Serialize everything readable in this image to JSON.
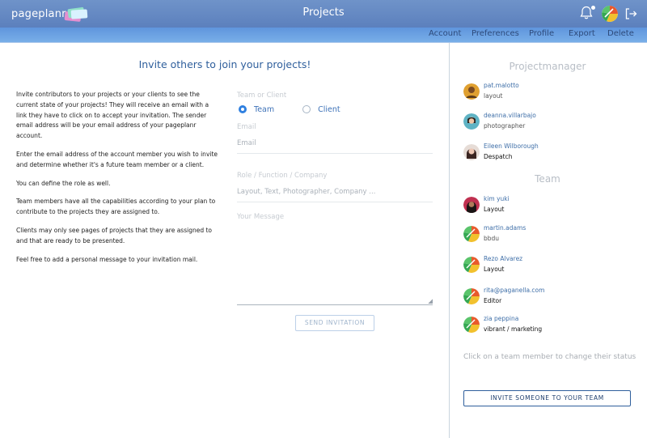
{
  "header": {
    "logo_text": "pageplanr",
    "title": "Projects",
    "icons": [
      "bell-icon",
      "user-avatar",
      "logout-icon"
    ]
  },
  "subnav": {
    "items": [
      "Account",
      "Preferences",
      "Profile",
      "Export",
      "Delete"
    ]
  },
  "main": {
    "title": "Invite others to join your projects!",
    "info": [
      "Invite contributors to your projects or your clients to see the current state of your projects! They will receive an email with a link they have to click on to accept your invitation. The sender email address will be your email address of your pageplanr account.",
      "Enter the email address of the account member you wish to invite and determine whether it's a future team member or a client.",
      "You can define the role as well.",
      "Team members have all the capabilities according to your plan to contribute to the projects they are assigned to.",
      "Clients may only see pages of projects that they are assigned to and that are ready to be presented.",
      "Feel free to add a personal message to your invitation mail."
    ],
    "form": {
      "team_or_client_label": "Team or Client",
      "option_team": "Team",
      "option_client": "Client",
      "selected": "Team",
      "email_label": "Email",
      "email_placeholder": "Email",
      "role_label": "Role / Function / Company",
      "role_placeholder": "Layout, Text, Photographer, Company ...",
      "message_label": "Your Message",
      "send_button": "SEND INVITATION"
    }
  },
  "sidebar": {
    "projectmanager_heading": "Projectmanager",
    "projectmanagers": [
      {
        "name": "pat.malotto",
        "role": "layout"
      },
      {
        "name": "deanna.villarbajo",
        "role": "photographer"
      },
      {
        "name": "Eileen Wilborough",
        "role": "Despatch"
      }
    ],
    "team_heading": "Team",
    "team": [
      {
        "name": "kim yuki",
        "role": "Layout"
      },
      {
        "name": "martin.adams",
        "role": "bbdu"
      },
      {
        "name": "Rezo Alvarez",
        "role": "Layout"
      },
      {
        "name": "rita@paganella.com",
        "role": "Editor"
      },
      {
        "name": "zia peppina",
        "role": "vibrant / marketing"
      }
    ],
    "hint": "Click on a team member to change their status",
    "invite_team_button": "INVITE SOMEONE TO YOUR TEAM"
  },
  "colors": {
    "header_bg": "#6286c2",
    "subnav_bg": "#6aa0e2",
    "accent_blue": "#2f5f9c",
    "radio_on": "#2f80e0"
  }
}
